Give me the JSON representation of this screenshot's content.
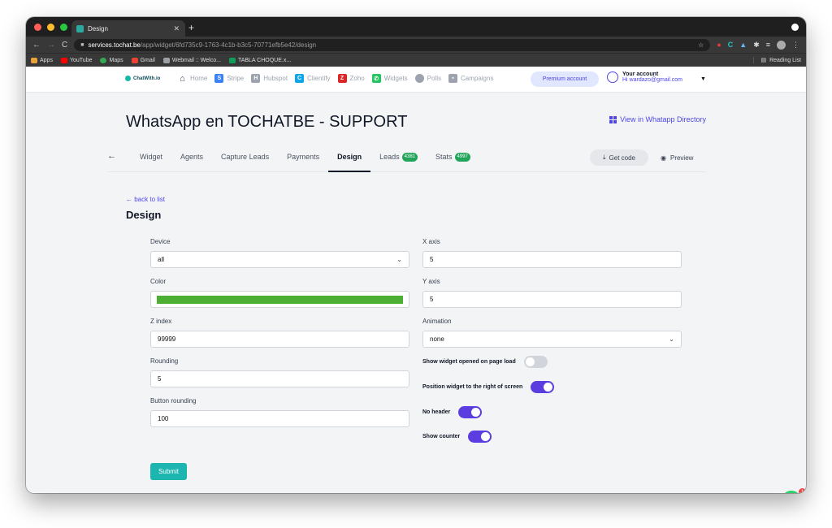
{
  "browser": {
    "tab_title": "Design",
    "url_host": "services.tochat.be",
    "url_path": "/app/widget/6fd735c9-1763-4c1b-b3c5-70771efb5e42/design",
    "bookmarks": [
      {
        "label": "Apps",
        "color": "#e8a23a"
      },
      {
        "label": "YouTube",
        "color": "#ff0000"
      },
      {
        "label": "Maps",
        "color": "#34a853"
      },
      {
        "label": "Gmail",
        "color": "#ea4335"
      },
      {
        "label": "Webmail :: Welco...",
        "color": "#9aa0a6"
      },
      {
        "label": "TABLA CHOQUE.x...",
        "color": "#0f9d58"
      }
    ],
    "reading_list": "Reading List"
  },
  "site": {
    "logo": "ChatWith.io",
    "nav": [
      {
        "label": "Home",
        "icon": "home-icon",
        "color": "#374151"
      },
      {
        "label": "Stripe",
        "icon": "stripe-icon",
        "color": "#3b82f6"
      },
      {
        "label": "Hubspot",
        "icon": "hubspot-icon",
        "color": "#9ca3af"
      },
      {
        "label": "Clientify",
        "icon": "clientify-icon",
        "color": "#0ea5e9"
      },
      {
        "label": "Zoho",
        "icon": "zoho-icon",
        "color": "#dc2626"
      },
      {
        "label": "Widgets",
        "icon": "whatsapp-icon",
        "color": "#22c55e"
      },
      {
        "label": "Polls",
        "icon": "pie-chart-icon",
        "color": "#9ca3af"
      },
      {
        "label": "Campaigns",
        "icon": "campaign-icon",
        "color": "#9ca3af"
      }
    ],
    "premium": "Premium account",
    "account_title": "Your account",
    "account_email": "Hi wardazo@gmail.com"
  },
  "page": {
    "title": "WhatsApp en TOCHATBE - SUPPORT",
    "directory_link": "View in Whatapp Directory",
    "tabs": [
      {
        "label": "Widget",
        "badge": ""
      },
      {
        "label": "Agents",
        "badge": ""
      },
      {
        "label": "Capture Leads",
        "badge": ""
      },
      {
        "label": "Payments",
        "badge": ""
      },
      {
        "label": "Design",
        "badge": "",
        "active": true
      },
      {
        "label": "Leads",
        "badge": "4381"
      },
      {
        "label": "Stats",
        "badge": "4997"
      }
    ],
    "get_code": "Get code",
    "preview": "Preview",
    "back_link": "back to list",
    "section_title": "Design"
  },
  "form": {
    "device_label": "Device",
    "device_value": "all",
    "color_label": "Color",
    "color_value": "#4caf34",
    "zindex_label": "Z index",
    "zindex_value": "99999",
    "rounding_label": "Rounding",
    "rounding_value": "5",
    "button_rounding_label": "Button rounding",
    "button_rounding_value": "100",
    "xaxis_label": "X axis",
    "xaxis_value": "5",
    "yaxis_label": "Y axis",
    "yaxis_value": "5",
    "animation_label": "Animation",
    "animation_value": "none",
    "toggles": [
      {
        "label": "Show widget opened on page load",
        "on": false
      },
      {
        "label": "Position widget to the right of screen",
        "on": true
      },
      {
        "label": "No header",
        "on": true
      },
      {
        "label": "Show counter",
        "on": true
      }
    ],
    "submit": "Submit"
  },
  "widget": {
    "badge_count": "1"
  }
}
